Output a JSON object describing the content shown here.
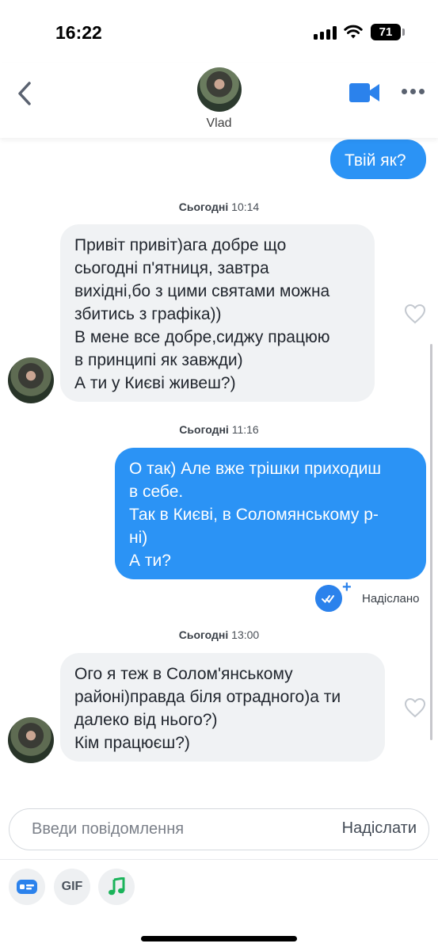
{
  "status_bar": {
    "time": "16:22",
    "battery": "71"
  },
  "header": {
    "contact_name": "Vlad"
  },
  "messages": [
    {
      "text": "Твій як?"
    },
    {
      "text": "Привіт привіт)ага добре що\nсьогодні п'ятниця, завтра\nвихідні,бо з цими святами можна\nзбитись з графіка))\nВ мене все добре,сиджу працюю\nв принципі як завжди)\nА ти у Києві живеш?)"
    },
    {
      "text": "О так) Але вже трішки приходиш\nв себе.\nТак в Києві, в Соломянському р-\nні)\nА ти?"
    },
    {
      "text": "Ого я теж в Солом'янському\nрайоні)правда біля отрадного)а ти\nдалеко від нього?)\nКім працюєш?)"
    }
  ],
  "timestamps": [
    {
      "day": "Сьогодні",
      "time": "10:14"
    },
    {
      "day": "Сьогодні",
      "time": "11:16"
    },
    {
      "day": "Сьогодні",
      "time": "13:00"
    }
  ],
  "delivery_status": "Надіслано",
  "composer": {
    "placeholder": "Введи повідомлення",
    "send_label": "Надіслати"
  },
  "toolbar": {
    "gif_label": "GIF"
  },
  "colors": {
    "accent": "#2b93f5",
    "incoming_bubble": "#f0f2f4",
    "music": "#1ab35a"
  }
}
